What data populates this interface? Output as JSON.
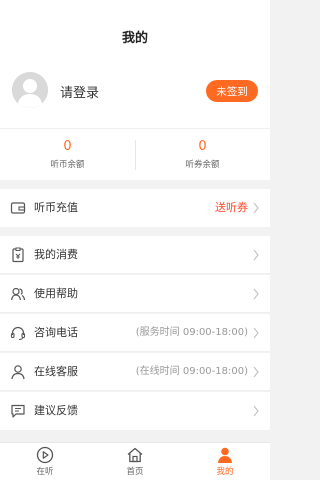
{
  "header": {
    "title": "我的"
  },
  "profile": {
    "login_text": "请登录",
    "signin_label": "未签到"
  },
  "balance": {
    "coins": {
      "value": "0",
      "label": "听币余额"
    },
    "vouchers": {
      "value": "0",
      "label": "听券余额"
    }
  },
  "menu": {
    "recharge": {
      "label": "听币充值",
      "right": "送听券"
    },
    "consumption": {
      "label": "我的消费"
    },
    "help": {
      "label": "使用帮助"
    },
    "hotline": {
      "label": "咨询电话",
      "right": "(服务时间 09:00-18:00)"
    },
    "service": {
      "label": "在线客服",
      "right": "(在线时间 09:00-18:00)"
    },
    "feedback": {
      "label": "建议反馈"
    }
  },
  "tabbar": {
    "tabs": [
      {
        "label": "在听",
        "icon": "play-circle-icon"
      },
      {
        "label": "首页",
        "icon": "home-icon"
      },
      {
        "label": "我的",
        "icon": "user-icon"
      }
    ],
    "active_color": "#ff6a23"
  },
  "colors": {
    "accent": "#ff6a23",
    "promo": "#ff4a2a"
  }
}
